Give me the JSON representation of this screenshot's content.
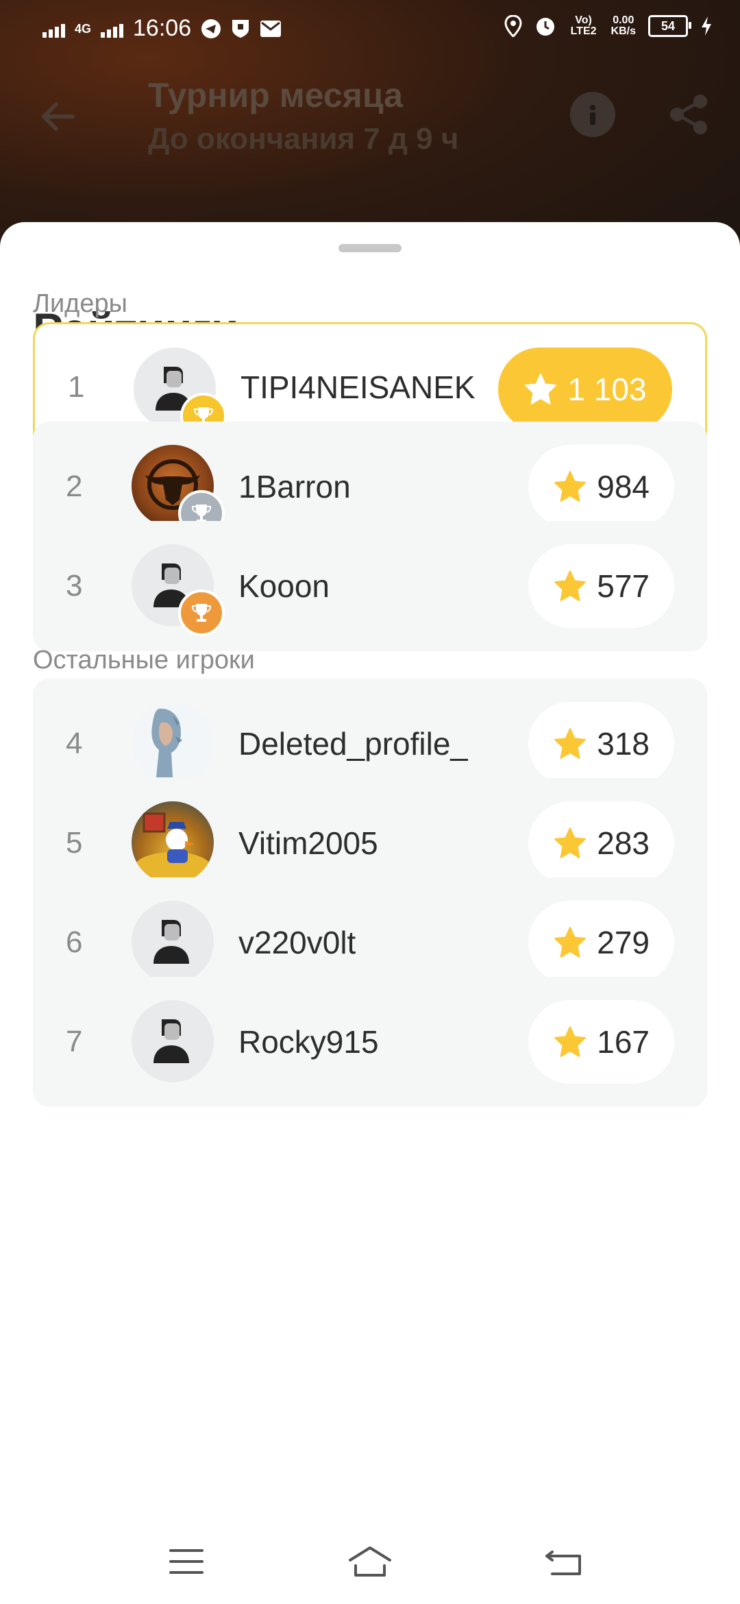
{
  "status_bar": {
    "time": "16:06",
    "network": "4G",
    "lte": "Vo) LTE2",
    "speed_value": "0.00",
    "speed_unit": "KB/s",
    "battery": "54"
  },
  "header": {
    "title": "Турнир месяца",
    "subtitle": "До окончания 7 д 9 ч"
  },
  "sheet": {
    "title": "Рейтинги",
    "leaders_label": "Лидеры",
    "others_label": "Остальные игроки"
  },
  "leaders": [
    {
      "rank": "1",
      "name": "TIPI4NEISANEK",
      "score": "1 103",
      "badge": "gold"
    },
    {
      "rank": "2",
      "name": "1Barron",
      "score": "984",
      "badge": "silver"
    },
    {
      "rank": "3",
      "name": "Kooon",
      "score": "577",
      "badge": "bronze"
    }
  ],
  "others": [
    {
      "rank": "4",
      "name": "Deleted_profile_",
      "score": "318"
    },
    {
      "rank": "5",
      "name": "Vitim2005",
      "score": "283"
    },
    {
      "rank": "6",
      "name": "v220v0lt",
      "score": "279"
    },
    {
      "rank": "7",
      "name": "Rocky915",
      "score": "167"
    }
  ],
  "colors": {
    "accent_gold": "#fcc734",
    "leader_border": "#f2d75a",
    "silver": "#a9b1bb",
    "bronze": "#ee9a3c"
  },
  "icons": [
    "back-arrow-icon",
    "info-icon",
    "share-icon",
    "star-icon",
    "trophy-icon",
    "menu-icon",
    "home-icon",
    "back-icon"
  ]
}
